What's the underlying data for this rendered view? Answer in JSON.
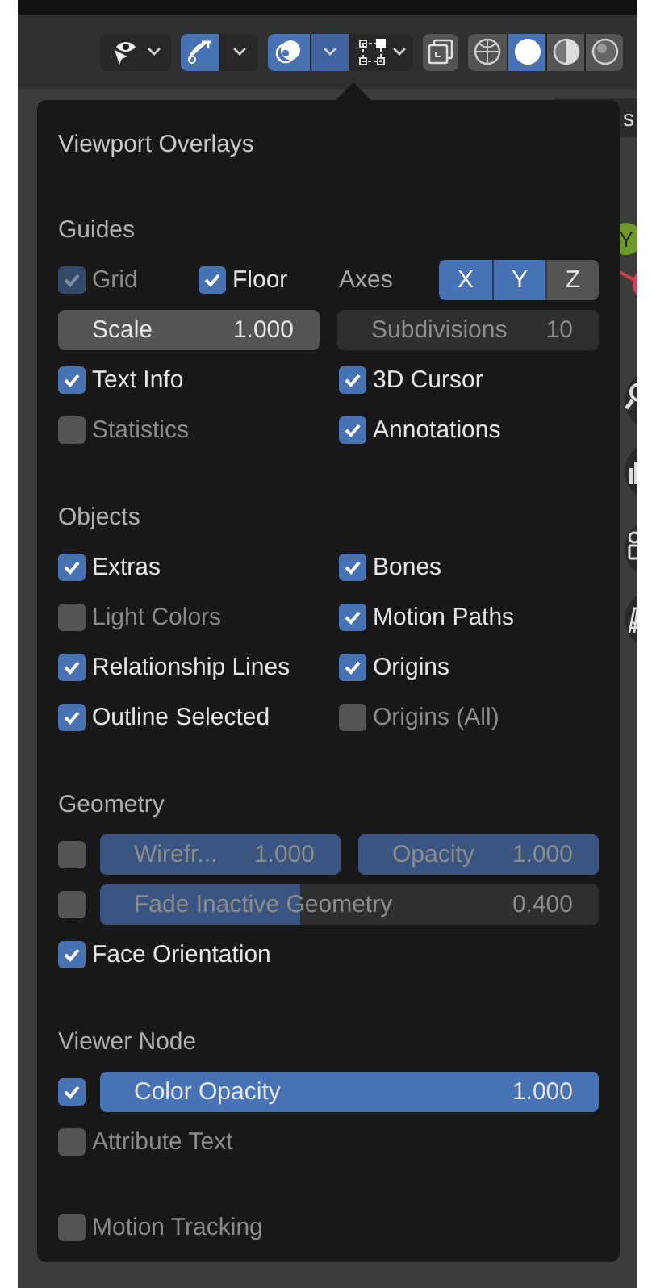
{
  "toolbar": {
    "groups": [
      {
        "buttons": [
          {
            "kind": "visibility",
            "selected": false
          }
        ]
      },
      {
        "buttons": [
          {
            "kind": "gizmo",
            "selected": true
          },
          {
            "kind": "dropdown",
            "selected": false
          }
        ]
      },
      {
        "buttons": [
          {
            "kind": "overlays",
            "selected": true
          },
          {
            "kind": "dropdown",
            "selected": true
          },
          {
            "kind": "mesh_select",
            "selected": false
          }
        ]
      },
      {
        "buttons": [
          {
            "kind": "xray",
            "selected": false
          }
        ]
      },
      {
        "buttons": [
          {
            "kind": "wireframe",
            "selected": false
          },
          {
            "kind": "solid",
            "selected": true
          },
          {
            "kind": "material",
            "selected": false
          },
          {
            "kind": "rendered",
            "selected": false
          }
        ]
      }
    ]
  },
  "header_fragment": "s",
  "gizmo": {
    "y_label": "Y"
  },
  "popup": {
    "title": "Viewport Overlays",
    "sections": [
      {
        "heading": "Guides",
        "rows": [
          {
            "kind": "grid_axes",
            "items": [
              {
                "label": "Grid",
                "checked": true,
                "disabled": true
              },
              {
                "label": "Floor",
                "checked": true,
                "disabled": false
              }
            ],
            "axes": {
              "label": "Axes",
              "buttons": [
                {
                  "label": "X",
                  "selected": true
                },
                {
                  "label": "Y",
                  "selected": true
                },
                {
                  "label": "Z",
                  "selected": false
                }
              ]
            }
          },
          {
            "kind": "fields",
            "fields": [
              {
                "label": "Scale",
                "value": "1.000",
                "disabled": false
              },
              {
                "label": "Subdivisions",
                "value": "10",
                "disabled": true
              }
            ]
          },
          {
            "kind": "checks",
            "items": [
              {
                "label": "Text Info",
                "checked": true,
                "disabled": false
              },
              {
                "label": "3D Cursor",
                "checked": true,
                "disabled": false
              }
            ]
          },
          {
            "kind": "checks",
            "items": [
              {
                "label": "Statistics",
                "checked": false,
                "disabled": true
              },
              {
                "label": "Annotations",
                "checked": true,
                "disabled": false
              }
            ]
          }
        ]
      },
      {
        "heading": "Objects",
        "rows": [
          {
            "kind": "checks",
            "items": [
              {
                "label": "Extras",
                "checked": true,
                "disabled": false
              },
              {
                "label": "Bones",
                "checked": true,
                "disabled": false
              }
            ]
          },
          {
            "kind": "checks",
            "items": [
              {
                "label": "Light Colors",
                "checked": false,
                "disabled": true
              },
              {
                "label": "Motion Paths",
                "checked": true,
                "disabled": false
              }
            ]
          },
          {
            "kind": "checks",
            "items": [
              {
                "label": "Relationship Lines",
                "checked": true,
                "disabled": false
              },
              {
                "label": "Origins",
                "checked": true,
                "disabled": false
              }
            ]
          },
          {
            "kind": "checks",
            "items": [
              {
                "label": "Outline Selected",
                "checked": true,
                "disabled": false
              },
              {
                "label": "Origins (All)",
                "checked": false,
                "disabled": true
              }
            ]
          }
        ]
      },
      {
        "heading": "Geometry",
        "rows": [
          {
            "kind": "check_fields",
            "checked": false,
            "fields": [
              {
                "label": "Wirefr...",
                "value": "1.000",
                "level": 1,
                "disabled": true
              },
              {
                "label": "Opacity",
                "value": "1.000",
                "level": 1,
                "disabled": true
              }
            ]
          },
          {
            "kind": "check_fields",
            "checked": false,
            "fields": [
              {
                "label": "Fade Inactive Geometry",
                "value": "0.400",
                "level": 0.4,
                "disabled": true
              }
            ]
          },
          {
            "kind": "checks",
            "items": [
              {
                "label": "Face Orientation",
                "checked": true,
                "disabled": false
              }
            ]
          }
        ]
      },
      {
        "heading": "Viewer Node",
        "rows": [
          {
            "kind": "check_fields",
            "checked": true,
            "fields": [
              {
                "label": "Color Opacity",
                "value": "1.000",
                "level": 1,
                "disabled": false
              }
            ]
          },
          {
            "kind": "checks",
            "items": [
              {
                "label": "Attribute Text",
                "checked": false,
                "disabled": true
              }
            ]
          }
        ]
      },
      {
        "rows": [
          {
            "kind": "checks",
            "items": [
              {
                "label": "Motion Tracking",
                "checked": false,
                "disabled": true
              }
            ]
          }
        ]
      }
    ]
  }
}
